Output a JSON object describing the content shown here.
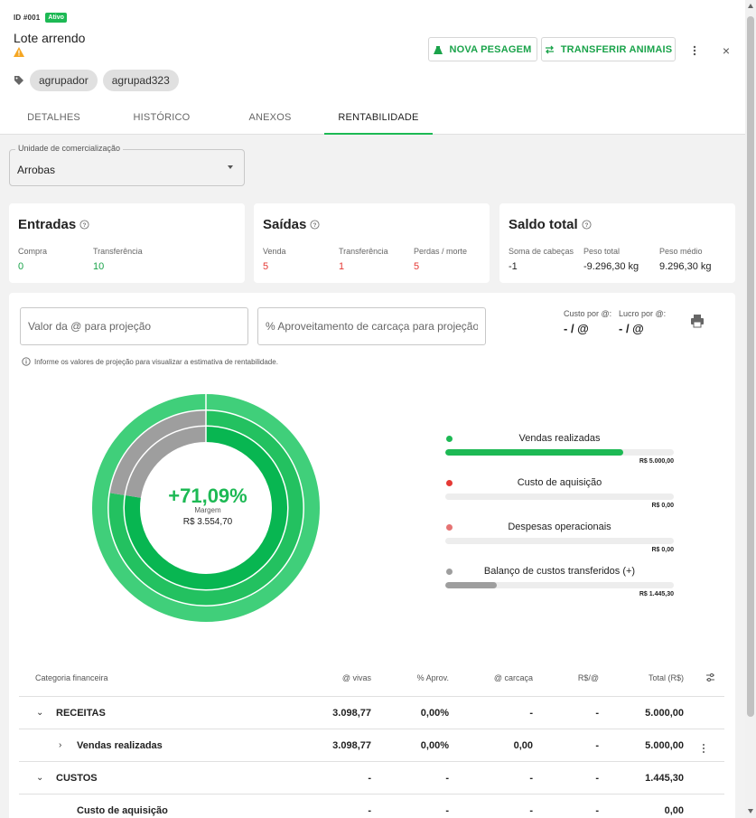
{
  "header": {
    "id_label": "ID #001",
    "status_badge": "Ativo",
    "title": "Lote arrendo",
    "tags": [
      "agrupador",
      "agrupad323"
    ],
    "btn_nova_pesagem": "NOVA PESAGEM",
    "btn_transferir": "TRANSFERIR ANIMAIS",
    "close_glyph": "×"
  },
  "tabs": [
    {
      "label": "DETALHES",
      "active": false
    },
    {
      "label": "HISTÓRICO",
      "active": false
    },
    {
      "label": "ANEXOS",
      "active": false
    },
    {
      "label": "RENTABILIDADE",
      "active": true
    }
  ],
  "unidade": {
    "label": "Unidade de comercialização",
    "value": "Arrobas"
  },
  "cards": {
    "entradas": {
      "title": "Entradas",
      "stats": [
        {
          "label": "Compra",
          "value": "0",
          "color": "green"
        },
        {
          "label": "Transferência",
          "value": "10",
          "color": "green"
        }
      ]
    },
    "saidas": {
      "title": "Saídas",
      "stats": [
        {
          "label": "Venda",
          "value": "5",
          "color": "red"
        },
        {
          "label": "Transferência",
          "value": "1",
          "color": "red"
        },
        {
          "label": "Perdas / morte",
          "value": "5",
          "color": "red"
        }
      ]
    },
    "saldo": {
      "title": "Saldo total",
      "stats": [
        {
          "label": "Soma de cabeças",
          "value": "-1",
          "color": "dark"
        },
        {
          "label": "Peso total",
          "value": "-9.296,30 kg",
          "color": "dark"
        },
        {
          "label": "Peso médio",
          "value": "9.296,30 kg",
          "color": "dark"
        }
      ]
    }
  },
  "projection": {
    "valor_placeholder": "Valor da @ para projeção",
    "aproveitamento_placeholder": "% Aproveitamento de carcaça para projeção",
    "custo_label": "Custo por @:",
    "custo_value": "- / @",
    "lucro_label": "Lucro por @:",
    "lucro_value": "- / @",
    "info_text": "Informe os valores de projeção para visualizar a estimativa de rentabilidade."
  },
  "donut": {
    "percent_text": "+71,09%",
    "margin_label": "Margem",
    "margin_value": "R$ 3.554,70",
    "rings": [
      {
        "name": "outer",
        "green_fraction": 1.0
      },
      {
        "name": "middle",
        "green_fraction": 0.7747
      },
      {
        "name": "inner",
        "green_fraction": 0.7747
      }
    ],
    "colors": {
      "green_light": "#40cf7a",
      "green_mid": "#23c160",
      "green_dark": "#08b651",
      "grey": "#9e9e9e"
    }
  },
  "legend": [
    {
      "label": "Vendas realizadas",
      "value": "R$ 5.000,00",
      "fraction": 0.78,
      "dot_color": "#1db954",
      "bar_color": "#1db954"
    },
    {
      "label": "Custo de aquisição",
      "value": "R$ 0,00",
      "fraction": 0,
      "dot_color": "#e53935",
      "bar_color": "#e53935"
    },
    {
      "label": "Despesas operacionais",
      "value": "R$ 0,00",
      "fraction": 0,
      "dot_color": "#e57373",
      "bar_color": "#e57373"
    },
    {
      "label": "Balanço de custos transferidos (+)",
      "value": "R$ 1.445,30",
      "fraction": 0.225,
      "dot_color": "#9e9e9e",
      "bar_color": "#9e9e9e"
    }
  ],
  "table": {
    "headers": [
      "Categoria financeira",
      "@ vivas",
      "% Aprov.",
      "@ carcaça",
      "R$/@",
      "Total (R$)"
    ],
    "rows": [
      {
        "chevron": "⌄",
        "category": "RECEITAS",
        "vivas": "3.098,77",
        "aprov": "0,00%",
        "carcaca": "-",
        "rs": "-",
        "total": "5.000,00",
        "bold": true,
        "indent": 0,
        "more": false
      },
      {
        "chevron": "›",
        "category": "Vendas realizadas",
        "vivas": "3.098,77",
        "aprov": "0,00%",
        "carcaca": "0,00",
        "rs": "-",
        "total": "5.000,00",
        "bold": true,
        "indent": 1,
        "more": true
      },
      {
        "chevron": "⌄",
        "category": "CUSTOS",
        "vivas": "-",
        "aprov": "-",
        "carcaca": "-",
        "rs": "-",
        "total": "1.445,30",
        "bold": true,
        "indent": 0,
        "more": false
      },
      {
        "chevron": "",
        "category": "Custo de aquisição",
        "vivas": "-",
        "aprov": "-",
        "carcaca": "-",
        "rs": "-",
        "total": "0,00",
        "bold": true,
        "indent": 1,
        "more": false
      }
    ]
  }
}
